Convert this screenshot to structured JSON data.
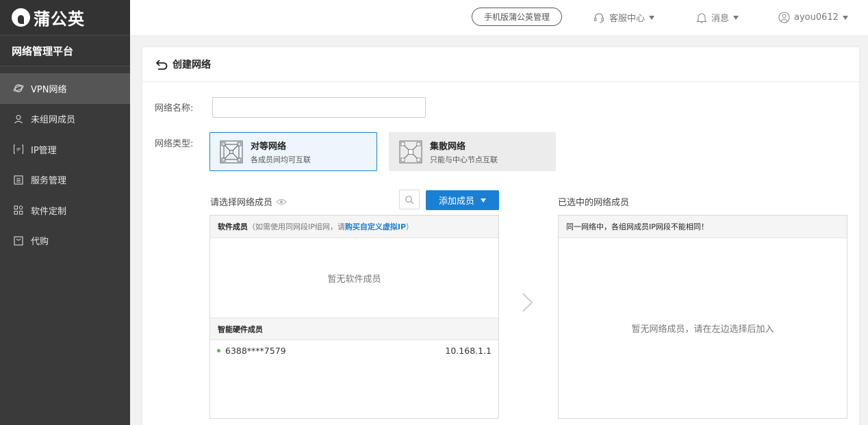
{
  "brand": {
    "name": "蒲公英"
  },
  "sidebar": {
    "platform_title": "网络管理平台",
    "items": [
      {
        "label": "VPN网络",
        "icon": "planet-icon",
        "active": true
      },
      {
        "label": "未组网成员",
        "icon": "user-icon",
        "active": false
      },
      {
        "label": "IP管理",
        "icon": "ip-icon",
        "active": false
      },
      {
        "label": "服务管理",
        "icon": "list-icon",
        "active": false
      },
      {
        "label": "软件定制",
        "icon": "grid-icon",
        "active": false
      },
      {
        "label": "代购",
        "icon": "bag-icon",
        "active": false
      }
    ]
  },
  "topbar": {
    "mobile_label": "手机版蒲公英管理",
    "support_label": "客服中心",
    "messages_label": "消息",
    "user_label": "ayou0612"
  },
  "page": {
    "title": "创建网络",
    "name_label": "网络名称:",
    "name_value": "",
    "type_label": "网络类型:",
    "types": [
      {
        "title": "对等网络",
        "desc": "各成员间均可互联",
        "selected": true
      },
      {
        "title": "集散网络",
        "desc": "只能与中心节点互联",
        "selected": false
      }
    ],
    "select_members_label": "请选择网络成员",
    "add_member_label": "添加成员",
    "selected_members_label": "已选中的网络成员",
    "software": {
      "title": "软件成员",
      "hint_prefix": "（如需使用同网段IP组网，请",
      "link": "购买自定义虚拟IP",
      "hint_suffix": "）",
      "empty": "暂无软件成员"
    },
    "hardware": {
      "title": "智能硬件成员",
      "members": [
        {
          "id": "6388****7579",
          "ip": "10.168.1.1",
          "online": true
        }
      ]
    },
    "selected_panel": {
      "notice": "同一网络中，各组网成员IP网段不能相同！",
      "empty": "暂无网络成员，请在左边选择后加入"
    }
  },
  "colors": {
    "accent": "#1a80d6",
    "sidebar": "#3a3a3a",
    "online": "#55b83a"
  }
}
